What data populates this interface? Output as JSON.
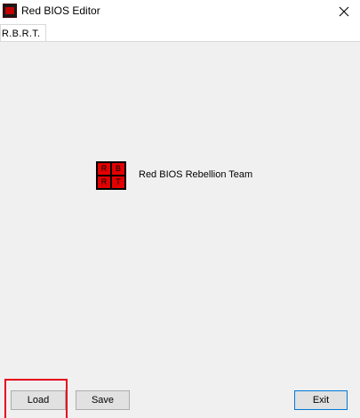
{
  "window": {
    "title": "Red BIOS Editor",
    "icon": "app-logo-icon",
    "close_icon": "close-icon"
  },
  "tabs": [
    {
      "label": "R.B.R.T."
    }
  ],
  "panel": {
    "logo": {
      "letters": [
        "R",
        "B",
        "R",
        "T"
      ],
      "cell_color": "#e30000",
      "frame_color": "#000000"
    },
    "team_name": "Red BIOS Rebellion Team"
  },
  "buttons": {
    "load": "Load",
    "save": "Save",
    "exit": "Exit"
  },
  "colors": {
    "highlight_box": "#e6001c",
    "focus_border": "#0078d7"
  }
}
